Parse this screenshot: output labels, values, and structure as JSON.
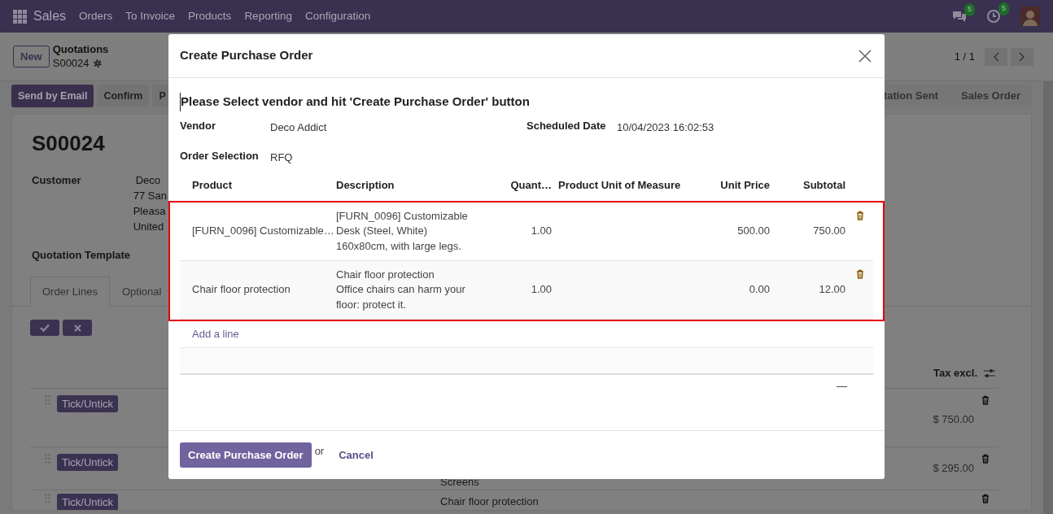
{
  "navbar": {
    "app": "Sales",
    "menu": [
      "Orders",
      "To Invoice",
      "Products",
      "Reporting",
      "Configuration"
    ],
    "messages_badge": "5",
    "activities_badge": "5"
  },
  "control_panel": {
    "new_button": "New",
    "breadcrumb": "Quotations",
    "record": "S00024",
    "pager": "1 / 1"
  },
  "actions": [
    {
      "label": "Send by Email",
      "kind": "primary"
    },
    {
      "label": "Confirm",
      "kind": "secondary"
    },
    {
      "label": "P",
      "kind": "secondary"
    }
  ],
  "status_steps": [
    "tation Sent",
    "Sales Order"
  ],
  "sheet": {
    "title": "S00024",
    "customer_label": "Customer",
    "customer_lines": [
      "Deco",
      "77 San",
      "Pleasa",
      "United"
    ],
    "template_label": "Quotation Template",
    "tabs": [
      {
        "label": "Order Lines",
        "selected": true
      },
      {
        "label": "Optional",
        "selected": false
      }
    ],
    "tax_header": "Tax excl.",
    "lines": [
      {
        "tag": "Tick/Untick",
        "amount": "$ 750.00"
      },
      {
        "tag": "Tick/Untick",
        "description": "Screens",
        "amount": "$ 295.00"
      },
      {
        "tag": "Tick/Untick",
        "description": "Chair floor protection"
      }
    ]
  },
  "dialog": {
    "title": "Create Purchase Order",
    "heading": "Please Select vendor and hit 'Create Purchase Order' button",
    "fields": [
      {
        "label": "Vendor",
        "value": "Deco Addict"
      },
      {
        "label": "Scheduled Date",
        "value": "10/04/2023 16:02:53"
      },
      {
        "label": "Order Selection",
        "value": "RFQ"
      }
    ],
    "columns": [
      "Product",
      "Description",
      "Quant…",
      "Product Unit of Measure",
      "Unit Price",
      "Subtotal"
    ],
    "rows": [
      {
        "product": "[FURN_0096] Customizable…",
        "description": "[FURN_0096] Customizable Desk (Steel, White)\n160x80cm, with large legs.",
        "quantity": "1.00",
        "unit_price": "500.00",
        "subtotal": "750.00"
      },
      {
        "product": "Chair floor protection",
        "description": "Chair floor protection\nOffice chairs can harm your floor: protect it.",
        "quantity": "1.00",
        "unit_price": "0.00",
        "subtotal": "12.00"
      }
    ],
    "add_line": "Add a line",
    "total": "—",
    "submit": "Create Purchase Order",
    "or": "or",
    "cancel": "Cancel"
  }
}
